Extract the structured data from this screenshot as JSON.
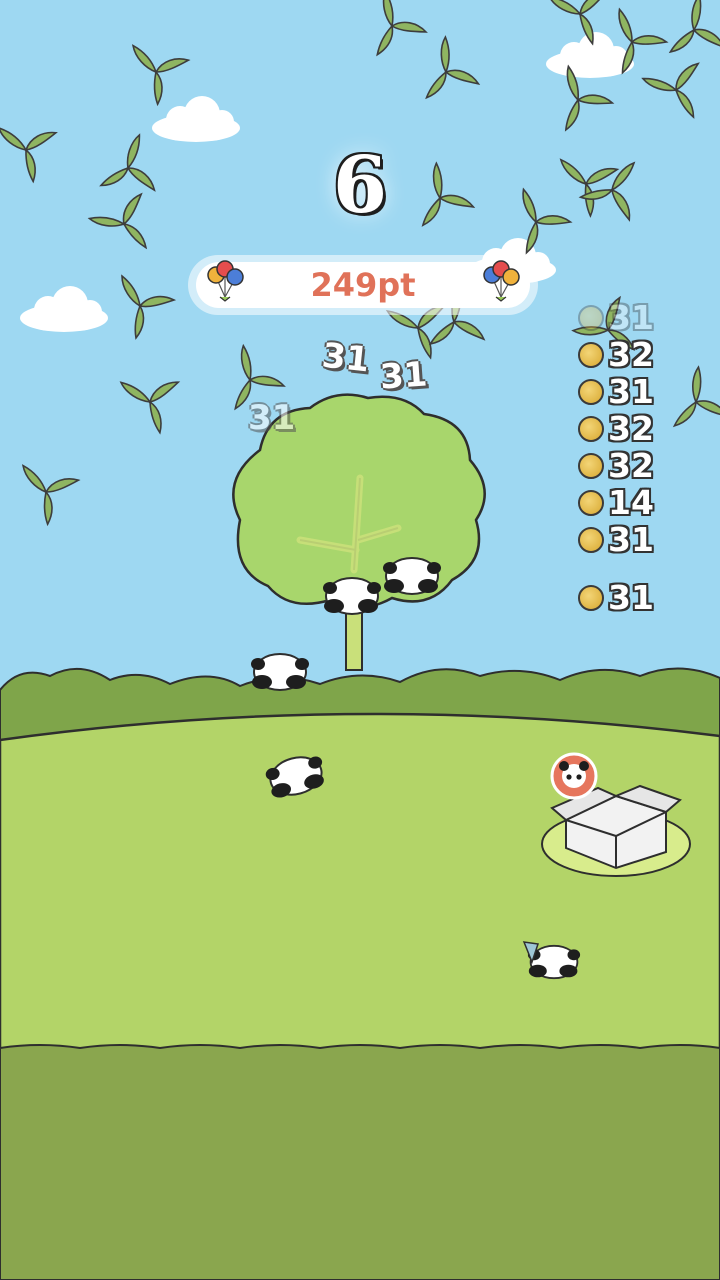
{
  "game": {
    "countdown": "6",
    "score": "249pt",
    "coin_log": [
      {
        "value": "31",
        "faded": true
      },
      {
        "value": "32",
        "faded": false
      },
      {
        "value": "31",
        "faded": false
      },
      {
        "value": "32",
        "faded": false
      },
      {
        "value": "32",
        "faded": false
      },
      {
        "value": "14",
        "faded": false
      },
      {
        "value": "31",
        "faded": false
      },
      {
        "value": "31",
        "faded": false
      }
    ],
    "floating_numbers": [
      "31",
      "31",
      "31",
      "31"
    ]
  },
  "icons": {
    "balloons_left": "balloons-icon",
    "balloons_right": "balloons-icon",
    "coin": "coin-icon",
    "panda_marker": "panda-face-icon"
  },
  "colors": {
    "sky": "#9ed8f2",
    "grass_light": "#b3d468",
    "grass_dark": "#8aa64e",
    "tree": "#a8d66c",
    "bamboo_leaf": "#8fb561",
    "score_text": "#e07259"
  }
}
